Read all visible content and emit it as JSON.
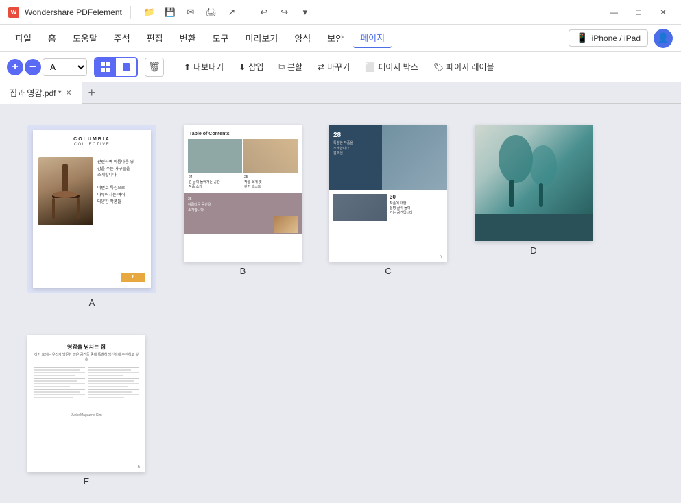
{
  "app": {
    "name": "Wondershare PDFelement",
    "logo_text": "W"
  },
  "titlebar": {
    "title": "Wondershare PDFelement",
    "actions": [
      "folder-icon",
      "save-icon",
      "email-icon",
      "print-icon",
      "share-icon"
    ],
    "undo": "↩",
    "redo": "↪",
    "dropdown": "▾",
    "min": "—",
    "max": "□",
    "close": "✕"
  },
  "menubar": {
    "items": [
      {
        "id": "file",
        "label": "파일"
      },
      {
        "id": "home",
        "label": "홈"
      },
      {
        "id": "help",
        "label": "도움말"
      },
      {
        "id": "annotate",
        "label": "주석"
      },
      {
        "id": "edit",
        "label": "편집"
      },
      {
        "id": "convert",
        "label": "변환"
      },
      {
        "id": "tools",
        "label": "도구"
      },
      {
        "id": "preview",
        "label": "미리보기"
      },
      {
        "id": "format",
        "label": "양식"
      },
      {
        "id": "protect",
        "label": "보안"
      },
      {
        "id": "page",
        "label": "페이지",
        "active": true
      }
    ],
    "device_label": "iPhone / iPad",
    "avatar_icon": "👤"
  },
  "toolbar": {
    "zoom_in": "+",
    "zoom_out": "−",
    "zoom_level": "A",
    "zoom_dropdown": "▾",
    "view_grid": "⊞",
    "view_single": "▭",
    "delete": "🗑",
    "extract_label": "내보내기",
    "insert_label": "삽입",
    "split_label": "분할",
    "replace_label": "바꾸기",
    "page_box_label": "페이지 박스",
    "page_label_label": "페이지 레이블"
  },
  "tabs": {
    "active_tab": "집과 영감.pdf *",
    "close": "✕",
    "add": "+"
  },
  "pages": [
    {
      "id": "A",
      "label": "A",
      "selected": true,
      "type": "cover"
    },
    {
      "id": "B",
      "label": "B",
      "selected": false,
      "type": "toc"
    },
    {
      "id": "C",
      "label": "C",
      "selected": false,
      "type": "interior"
    },
    {
      "id": "D",
      "label": "D",
      "selected": false,
      "type": "photo"
    },
    {
      "id": "E",
      "label": "E",
      "selected": false,
      "type": "article"
    }
  ],
  "page_content": {
    "a_title": "COLUMBIA",
    "a_subtitle": "COLLECTIVE",
    "a_body": "관련하여 아름다운 영\n감을 주는 가구들을\n소개합니다",
    "b_title": "Table of Contents",
    "b_num1": "24",
    "b_num2": "25",
    "c_num1": "28",
    "c_num2": "30",
    "e_title": "영감을 넘치는 집",
    "e_subtitle": "이번 호에는 우리가 방문한 많은 공간들 중에 특별히 당신에게 추천하고 싶은",
    "e_footnote": "JunhoMagazine Kim"
  }
}
